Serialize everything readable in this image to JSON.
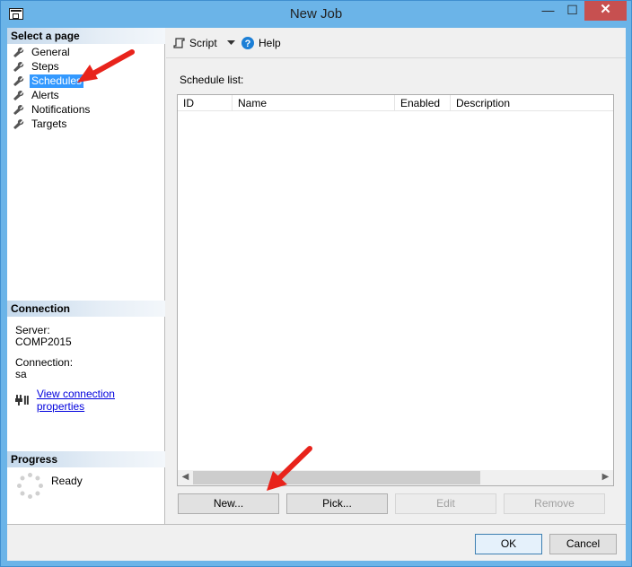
{
  "window": {
    "title": "New Job"
  },
  "title_buttons": {
    "minimize": "—",
    "maximize": "☐",
    "close": "✕"
  },
  "left": {
    "select_page_header": "Select a page",
    "pages": [
      {
        "label": "General",
        "icon": "wrench-icon"
      },
      {
        "label": "Steps",
        "icon": "wrench-icon"
      },
      {
        "label": "Schedules",
        "icon": "wrench-icon",
        "selected": true
      },
      {
        "label": "Alerts",
        "icon": "wrench-icon"
      },
      {
        "label": "Notifications",
        "icon": "wrench-icon"
      },
      {
        "label": "Targets",
        "icon": "wrench-icon"
      }
    ],
    "connection_header": "Connection",
    "server_label": "Server:",
    "server_value": "COMP2015",
    "connection_label": "Connection:",
    "connection_value": "sa",
    "view_connection_link": "View connection properties",
    "progress_header": "Progress",
    "progress_status": "Ready"
  },
  "toolbar": {
    "script_label": "Script",
    "help_label": "Help"
  },
  "main": {
    "schedule_list_label": "Schedule list:",
    "columns": [
      "ID",
      "Name",
      "Enabled",
      "Description"
    ],
    "rows": []
  },
  "buttons": {
    "new": "New...",
    "pick": "Pick...",
    "edit": "Edit",
    "remove": "Remove",
    "ok": "OK",
    "cancel": "Cancel"
  },
  "colors": {
    "title_bar": "#6bb4e8",
    "selection": "#3399ff",
    "close_button": "#c75050",
    "annotation_arrow": "#e8231b",
    "link": "#0000dd"
  }
}
